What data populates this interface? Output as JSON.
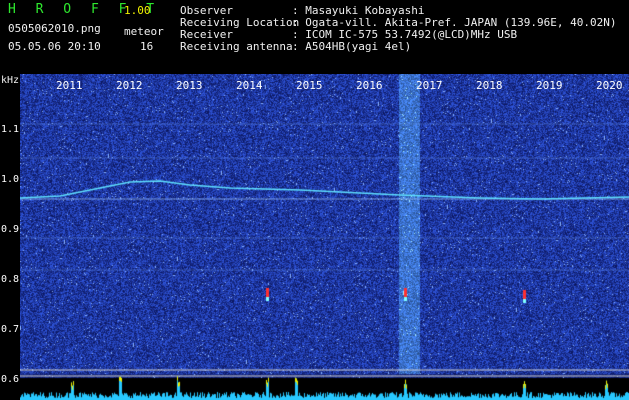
{
  "header": {
    "app_title": "H R O F F T",
    "version": "1.00",
    "filename": "0505062010.png",
    "datetime": "05.05.06 20:10",
    "meteor_label": "meteor",
    "meteor_count": "16",
    "observer_label": "Observer",
    "observer_value": ": Masayuki Kobayashi",
    "location_label": "Receiving Location",
    "location_value": ": Ogata-vill. Akita-Pref. JAPAN (139.96E, 40.02N)",
    "receiver_label": "Receiver",
    "receiver_value": ": ICOM IC-575 53.7492(@LCD)MHz USB",
    "antenna_label": "Receiving antenna",
    "antenna_value": ": A504HB(yagi 4el)"
  },
  "axis": {
    "unit": "kHz",
    "y_ticks": [
      {
        "label": "1.1",
        "value": 1.1
      },
      {
        "label": "1.0",
        "value": 1.0
      },
      {
        "label": "0.9",
        "value": 0.9
      },
      {
        "label": "0.8",
        "value": 0.8
      },
      {
        "label": "0.7",
        "value": 0.7
      },
      {
        "label": "0.6",
        "value": 0.6
      }
    ],
    "x_ticks": [
      {
        "label": "2011",
        "value": 2011
      },
      {
        "label": "2012",
        "value": 2012
      },
      {
        "label": "2013",
        "value": 2013
      },
      {
        "label": "2014",
        "value": 2014
      },
      {
        "label": "2015",
        "value": 2015
      },
      {
        "label": "2016",
        "value": 2016
      },
      {
        "label": "2017",
        "value": 2017
      },
      {
        "label": "2018",
        "value": 2018
      },
      {
        "label": "2019",
        "value": 2019
      },
      {
        "label": "2020",
        "value": 2020
      }
    ]
  },
  "colors": {
    "label_green": "#2ee82e",
    "label_white": "#f0f0f0",
    "version_yellow": "#f0f000",
    "background_noise": "#1a2fa8",
    "trace": "#5fe0ff",
    "meteor_red": "#ff3030"
  }
}
